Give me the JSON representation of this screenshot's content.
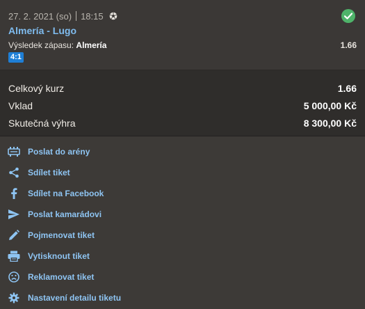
{
  "match": {
    "date": "27. 2. 2021 (so)",
    "time": "18:15",
    "sport_icon": "soccer-ball-icon",
    "status_icon": "check-circle-icon",
    "status_color": "#4fb36a",
    "teams": "Almería - Lugo",
    "market_label": "Výsledek zápasu:",
    "market_pick": "Almería",
    "odd": "1.66",
    "score": "4:1",
    "score_color": "#1f7fd6"
  },
  "summary": {
    "rows": [
      {
        "label": "Celkový kurz",
        "value": "1.66"
      },
      {
        "label": "Vklad",
        "value": "5 000,00 Kč"
      },
      {
        "label": "Skutečná výhra",
        "value": "8 300,00 Kč"
      }
    ]
  },
  "actions": [
    {
      "label": "Poslat do arény",
      "icon": "arena-icon"
    },
    {
      "label": "Sdílet tiket",
      "icon": "share-icon"
    },
    {
      "label": "Sdílet na Facebook",
      "icon": "facebook-icon"
    },
    {
      "label": "Poslat kamarádovi",
      "icon": "send-icon"
    },
    {
      "label": "Pojmenovat tiket",
      "icon": "pencil-icon"
    },
    {
      "label": "Vytisknout tiket",
      "icon": "printer-icon"
    },
    {
      "label": "Reklamovat tiket",
      "icon": "sad-face-icon"
    },
    {
      "label": "Nastavení detailu tiketu",
      "icon": "gear-icon"
    }
  ],
  "colors": {
    "link": "#8ec4f2",
    "team": "#7fbcef",
    "panel": "#3d3a37",
    "summary_bg": "#2f2d2b"
  }
}
